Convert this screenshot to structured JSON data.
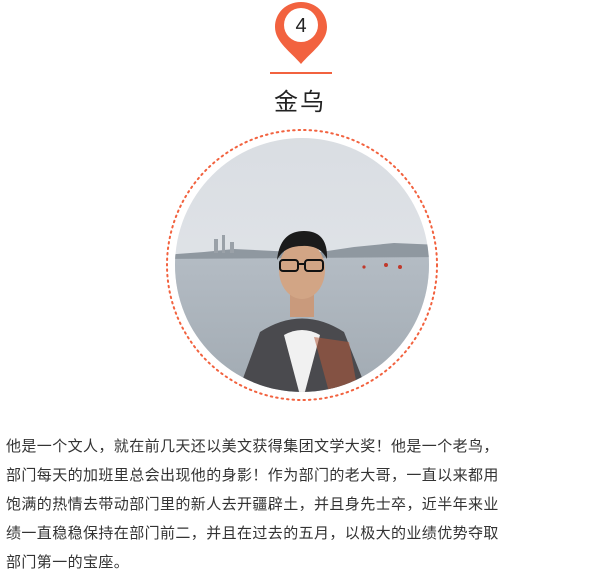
{
  "badge": {
    "number": "4",
    "color": "#f2623f"
  },
  "profile": {
    "name": "金乌",
    "photo_icon": "profile-photo"
  },
  "description": {
    "lines": [
      "他是一个文人，就在前几天还以美文获得集团文学大奖！他是一个老鸟，",
      "部门每天的加班里总会出现他的身影！作为部门的老大哥，一直以来都用",
      "饱满的热情去带动部门里的新人去开疆辟土，并且身先士卒，近半年来业",
      "绩一直稳稳保持在部门前二，并且在过去的五月，以极大的业绩优势夺取",
      "部门第一的宝座。"
    ]
  }
}
